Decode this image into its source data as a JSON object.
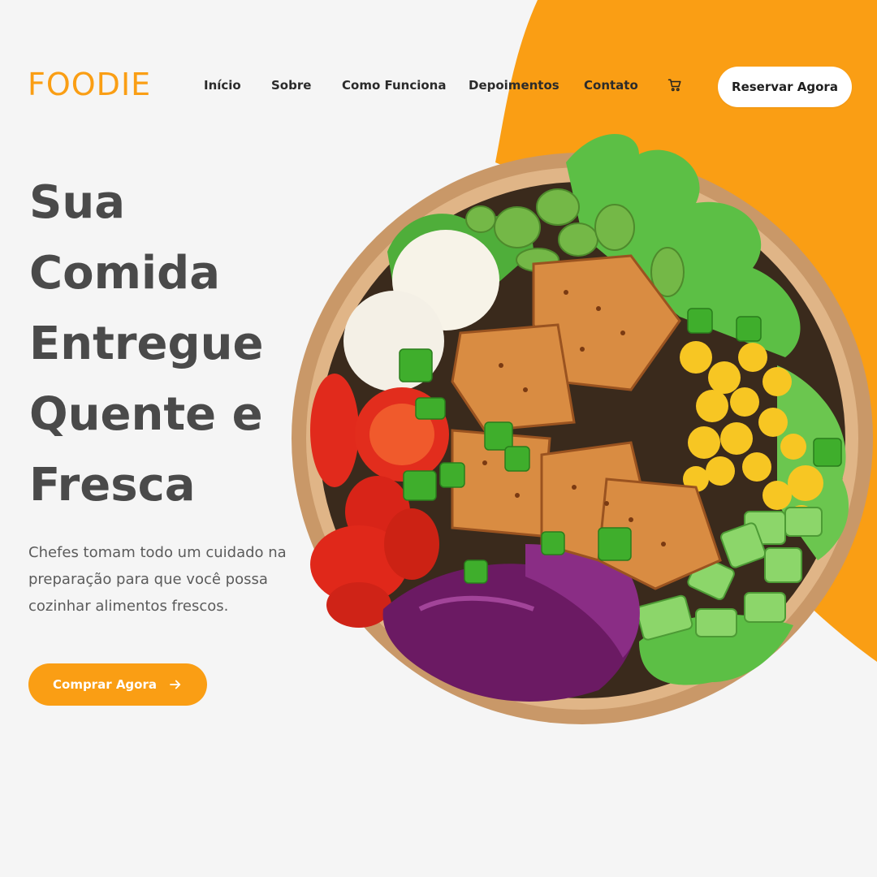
{
  "brand": {
    "logo": "FOODIE",
    "accent_color": "#fa9e14"
  },
  "nav": {
    "items": [
      {
        "label": "Início"
      },
      {
        "label": "Sobre"
      },
      {
        "label": "Como Funciona"
      },
      {
        "label": "Depoimentos"
      },
      {
        "label": "Contato"
      }
    ],
    "cart_icon": "cart-icon",
    "cta_label": "Reservar Agora"
  },
  "hero": {
    "title_lines": [
      "Sua",
      "Comida",
      "Entregue",
      "Quente e",
      "Fresca"
    ],
    "description": "Chefes tomam todo um cuidado na preparação para que você possa cozinhar alimentos frescos.",
    "cta_label": "Comprar Agora",
    "cta_icon": "arrow-right-icon",
    "image_subject": "salad-bowl"
  }
}
